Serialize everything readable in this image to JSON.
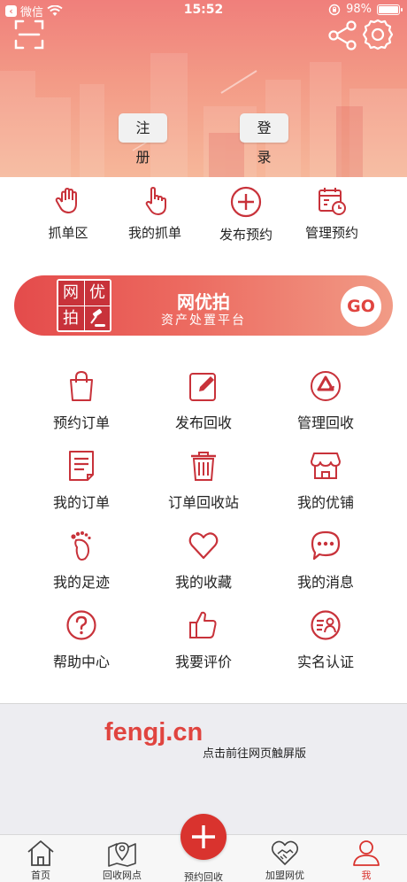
{
  "status_bar": {
    "carrier": "微信",
    "time": "15:52",
    "battery": "98%",
    "battery_level": 0.98
  },
  "header": {
    "register_label": "注册",
    "login_label": "登录"
  },
  "quick_actions": [
    {
      "label": "抓单区",
      "icon": "hand-icon"
    },
    {
      "label": "我的抓单",
      "icon": "finger-pointer-icon"
    },
    {
      "label": "发布预约",
      "icon": "plus-circle-icon"
    },
    {
      "label": "管理预约",
      "icon": "calendar-clock-icon"
    }
  ],
  "banner": {
    "logo_chars": [
      "网",
      "优",
      "拍"
    ],
    "title": "网优拍",
    "subtitle": "资产处置平台",
    "go_label": "GO"
  },
  "grid": [
    {
      "label": "预约订单",
      "icon": "shopping-bag-icon"
    },
    {
      "label": "发布回收",
      "icon": "edit-icon"
    },
    {
      "label": "管理回收",
      "icon": "recycle-icon"
    },
    {
      "label": "我的订单",
      "icon": "document-icon"
    },
    {
      "label": "订单回收站",
      "icon": "trash-icon"
    },
    {
      "label": "我的优铺",
      "icon": "shop-icon"
    },
    {
      "label": "我的足迹",
      "icon": "footprint-icon"
    },
    {
      "label": "我的收藏",
      "icon": "heart-icon"
    },
    {
      "label": "我的消息",
      "icon": "message-icon"
    },
    {
      "label": "帮助中心",
      "icon": "help-icon"
    },
    {
      "label": "我要评价",
      "icon": "thumbs-up-icon"
    },
    {
      "label": "实名认证",
      "icon": "id-card-icon"
    }
  ],
  "web_footer": {
    "logo": "fengj.cn",
    "hint": "点击前往网页触屏版"
  },
  "tabbar": [
    {
      "label": "首页",
      "icon": "home-icon"
    },
    {
      "label": "回收网点",
      "icon": "map-pin-icon"
    },
    {
      "label": "预约回收",
      "icon": "plus-icon"
    },
    {
      "label": "加盟网优",
      "icon": "handshake-heart-icon"
    },
    {
      "label": "我",
      "icon": "user-icon",
      "active": true
    }
  ],
  "colors": {
    "accent": "#d9332e",
    "header_top": "#f07f7b",
    "header_bottom": "#f6b79a",
    "web_logo": "#e0443f"
  }
}
